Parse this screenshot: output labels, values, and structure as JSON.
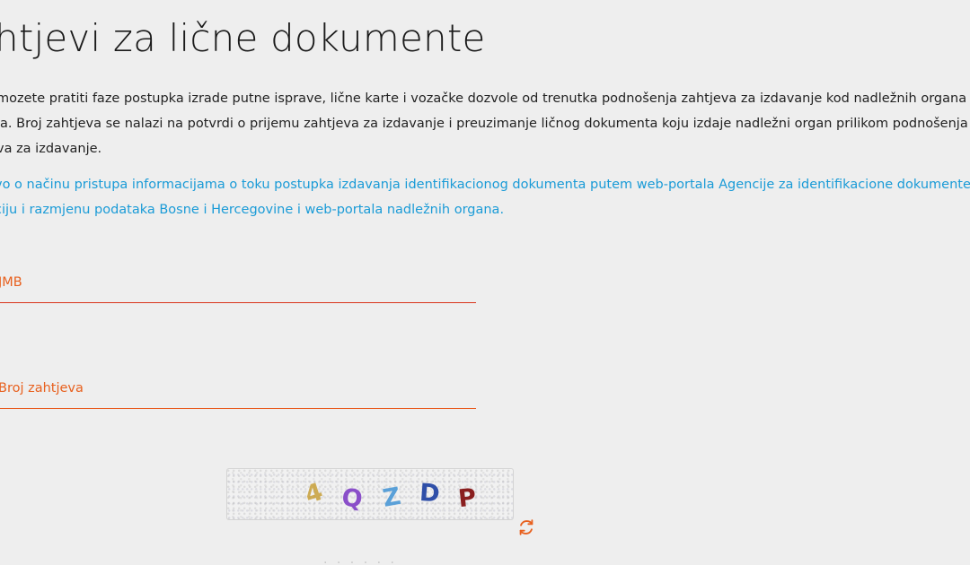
{
  "page": {
    "title": "htjevi za lične dokumente"
  },
  "description": {
    "line1": "mozete pratiti faze postupka izrade putne isprave, lične karte i vozačke dozvole od trenutka podnošenja zahtjeva za izdavanje kod nadležnih organa",
    "line2": "ja. Broj zahtjeva se nalazi na potvrdi o prijemu zahtjeva za izdavanje i preuzimanje ličnog dokumenta koju izdaje nadležni organ prilikom podnošenja",
    "line3": "va za izdavanje."
  },
  "info_link": {
    "line1": "vo o načinu pristupa informacijama o toku postupka izdavanja identifikacionog dokumenta putem web-portala Agencije za identifikacione dokumente",
    "line2": "ciju i razmjenu podataka Bosne i Hercegovine i web-portala nadležnih organa."
  },
  "form": {
    "jmb_placeholder": "JMB",
    "jmb_value": "",
    "broj_placeholder": "Broj zahtjeva",
    "broj_value": ""
  },
  "captcha": {
    "chars": [
      "4",
      "Q",
      "Z",
      "D",
      "P"
    ],
    "colors": [
      "#c9a13a",
      "#8a4fc9",
      "#5aa0d8",
      "#2f4fa8",
      "#8a1f1f"
    ]
  },
  "icons": {
    "refresh": "refresh-icon",
    "refresh_color": "#e8601e"
  }
}
